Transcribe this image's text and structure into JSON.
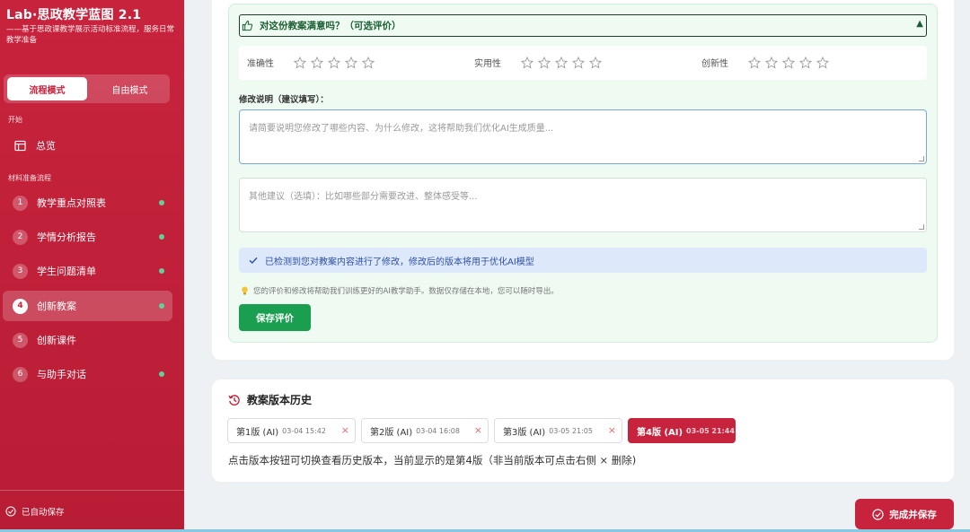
{
  "sidebar": {
    "title": "Lab·思政教学蓝图 2.1",
    "subtitle": "——基于思政课教学展示活动标准流程，服务日常教学准备",
    "modes": {
      "flow": "流程模式",
      "free": "自由模式"
    },
    "section_start": "开始",
    "overview": "总览",
    "section_materials": "材料准备流程",
    "items": [
      {
        "num": "1",
        "label": "教学重点对照表",
        "done": true
      },
      {
        "num": "2",
        "label": "学情分析报告",
        "done": true
      },
      {
        "num": "3",
        "label": "学生问题清单",
        "done": true
      },
      {
        "num": "4",
        "label": "创新教案",
        "done": true,
        "active": true
      },
      {
        "num": "5",
        "label": "创新课件",
        "done": false
      },
      {
        "num": "6",
        "label": "与助手对话",
        "done": true
      }
    ],
    "autosave": "已自动保存"
  },
  "feedback": {
    "title": "对这份教案满意吗？（可选评价）",
    "caret": "▲",
    "ratings": [
      {
        "label": "准确性",
        "stars": 0,
        "max": 5
      },
      {
        "label": "实用性",
        "stars": 0,
        "max": 5
      },
      {
        "label": "创新性",
        "stars": 0,
        "max": 5
      }
    ],
    "modification_label": "修改说明（建议填写）：",
    "modification_placeholder": "请简要说明您修改了哪些内容、为什么修改，这将帮助我们优化AI生成质量...",
    "other_placeholder": "其他建议（选填）：比如哪些部分需要改进、整体感受等...",
    "detected_notice": "已检测到您对教案内容进行了修改，修改后的版本将用于优化AI模型",
    "tip": "您的评价和修改将帮助我们训练更好的AI教学助手。数据仅存储在本地，您可以随时导出。",
    "save_label": "保存评价"
  },
  "history": {
    "title": "教案版本历史",
    "versions": [
      {
        "label": "第1版 (AI)",
        "time": "03-04 15:42",
        "current": false
      },
      {
        "label": "第2版 (AI)",
        "time": "03-04 16:08",
        "current": false
      },
      {
        "label": "第3版 (AI)",
        "time": "03-05 21:05",
        "current": false
      },
      {
        "label": "第4版 (AI)",
        "time": "03-05 21:44",
        "current": true
      }
    ],
    "delete_glyph": "×",
    "note": "点击版本按钮可切换查看历史版本，当前显示的是第4版（非当前版本可点击右侧 × 删除)"
  },
  "finish_label": "完成并保存",
  "colors": {
    "brand": "#c8233d",
    "success": "#1a9e4f",
    "info_bg": "#dde9fb",
    "done_dot": "#5fd19a"
  }
}
